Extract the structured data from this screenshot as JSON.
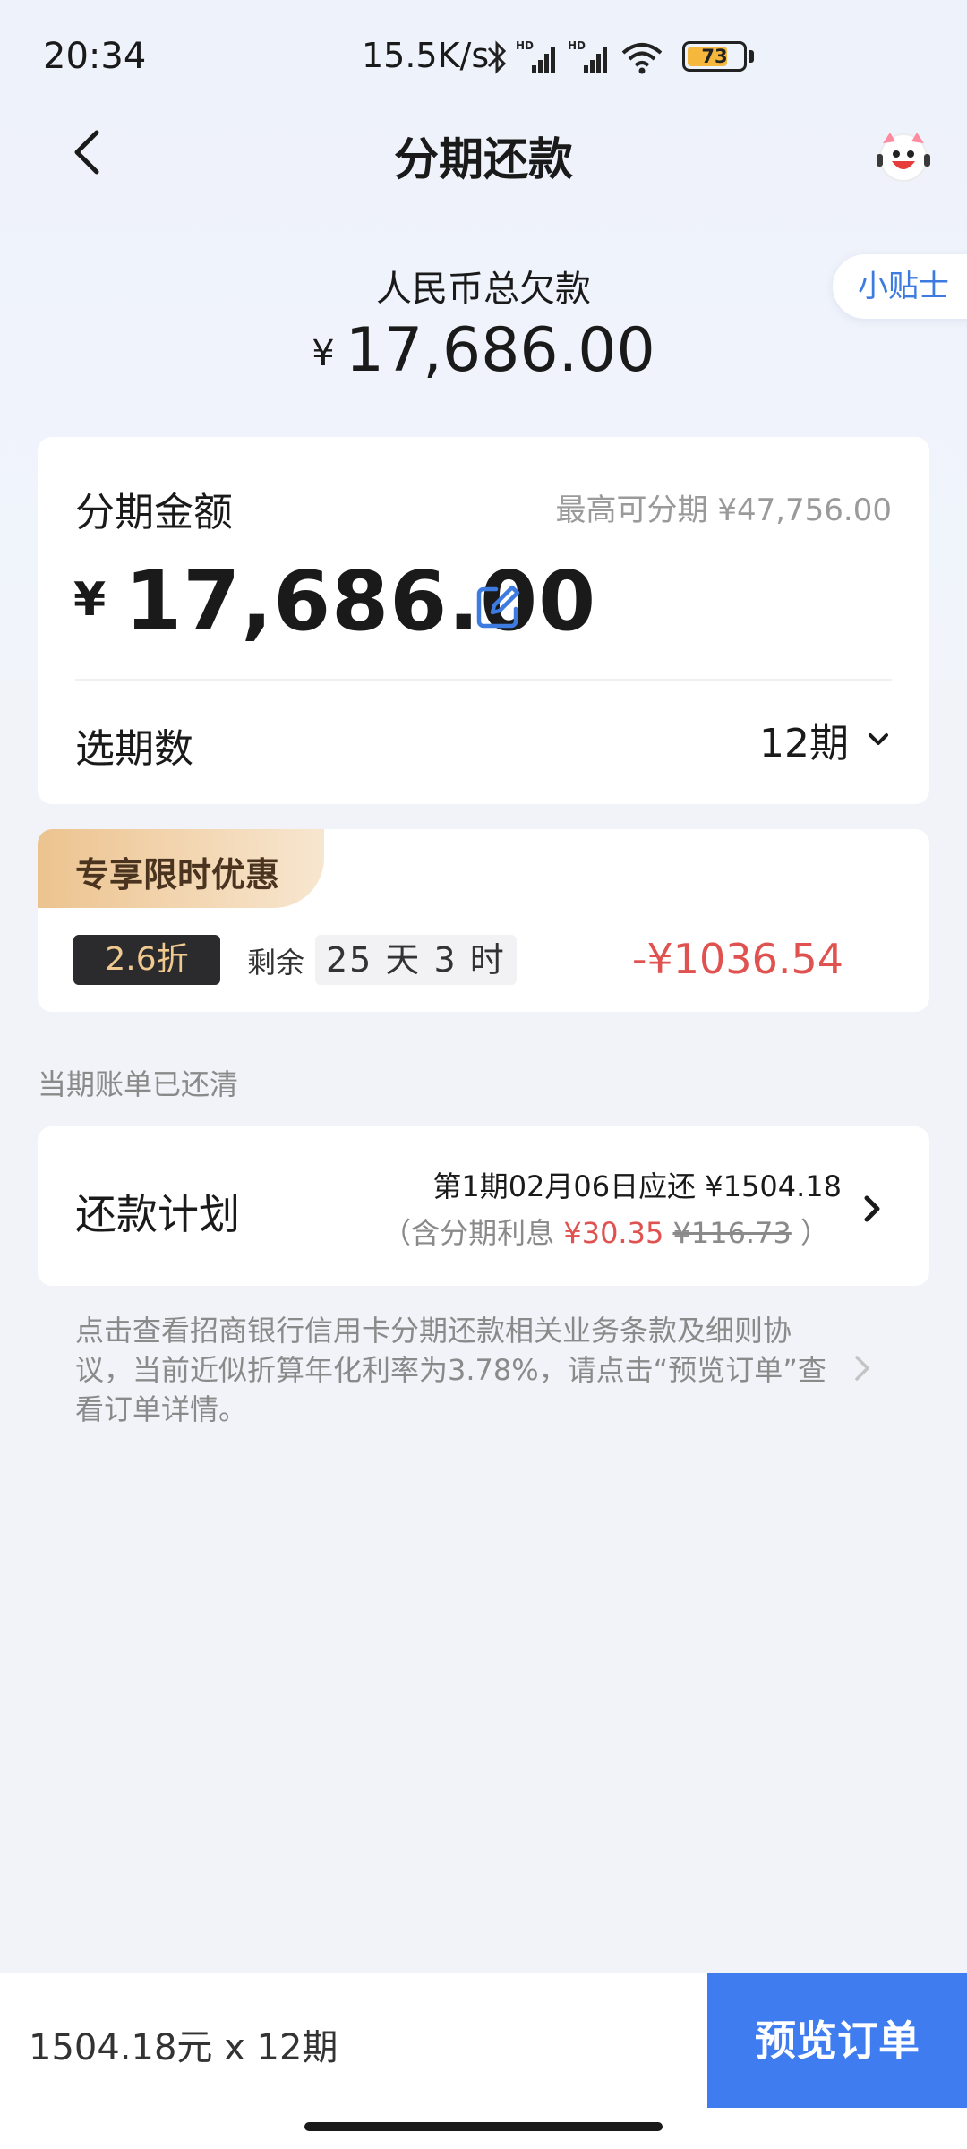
{
  "status_bar": {
    "time": "20:34",
    "net_speed": "15.5K/s",
    "battery_level": "73",
    "battery_fraction": 0.73,
    "icons": [
      "bluetooth-icon",
      "hd-signal-icon",
      "hd-signal-icon",
      "wifi-icon",
      "battery-icon"
    ]
  },
  "nav": {
    "title": "分期还款",
    "back_icon": "back-arrow-icon",
    "avatar_icon": "customer-service-mascot-icon"
  },
  "total": {
    "label": "人民币总欠款",
    "currency": "¥",
    "amount": "17,686.00",
    "tips_label": "小贴士"
  },
  "installment": {
    "label": "分期金额",
    "max_text": "最高可分期 ¥47,756.00",
    "currency": "¥",
    "amount": "17,686.00",
    "edit_icon": "edit-icon",
    "period_label": "选期数",
    "period_value": "12期"
  },
  "promo": {
    "tag": "专享限时优惠",
    "discount": "2.6折",
    "remain_label": "剩余",
    "remain_time": "25 天 3 时",
    "saving": "-¥1036.54"
  },
  "settled_note": "当期账单已还清",
  "plan": {
    "label": "还款计划",
    "line1": "第1期02月06日应还 ¥1504.18",
    "line2_prefix": "（含分期利息",
    "interest": "¥30.35",
    "original_interest": "¥116.73",
    "line2_suffix": "）"
  },
  "agreement_text": "点击查看招商银行信用卡分期还款相关业务条款及细则协议，当前近似折算年化利率为3.78%，请点击“预览订单”查看订单详情。",
  "bottom": {
    "summary": "1504.18元 x 12期",
    "preview_button": "预览订单"
  },
  "colors": {
    "accent": "#3f7cf0",
    "link": "#3d7be0",
    "price_red": "#e0524f",
    "promo_gold": "#ecc38f"
  }
}
